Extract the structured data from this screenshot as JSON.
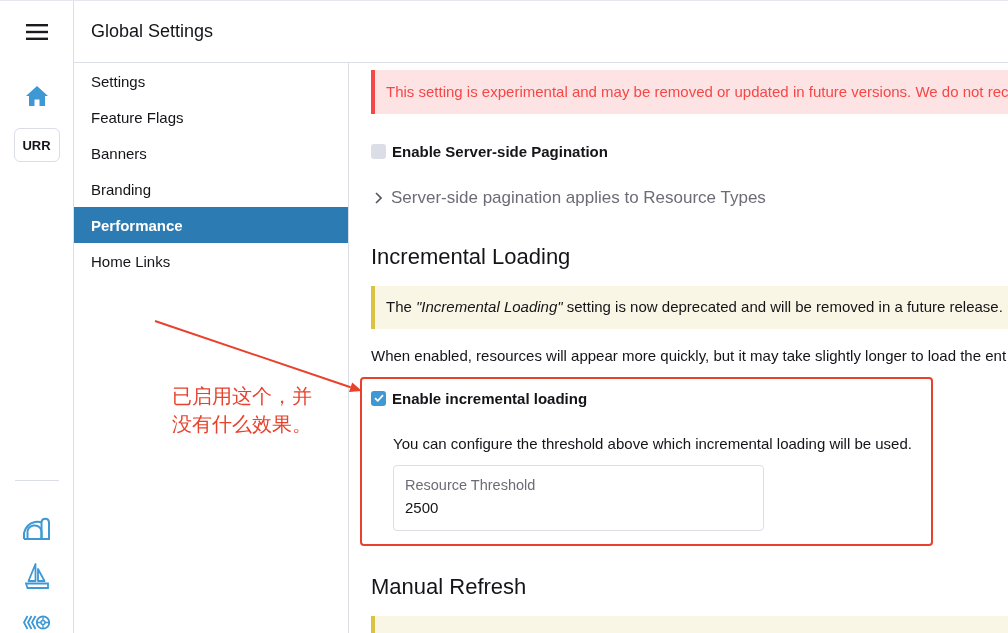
{
  "rail": {
    "cluster_label": "URR"
  },
  "header": {
    "title": "Global Settings"
  },
  "settings_nav": {
    "items": [
      {
        "label": "Settings",
        "selected": false
      },
      {
        "label": "Feature Flags",
        "selected": false
      },
      {
        "label": "Banners",
        "selected": false
      },
      {
        "label": "Branding",
        "selected": false
      },
      {
        "label": "Performance",
        "selected": true
      },
      {
        "label": "Home Links",
        "selected": false
      }
    ]
  },
  "performance": {
    "experimental_banner": {
      "kind": "error",
      "text": "This setting is experimental and may be removed or updated in future versions. We do not rec"
    },
    "server_pagination": {
      "label": "Enable Server-side Pagination",
      "checked": false
    },
    "pagination_resource_types": {
      "label": "Server-side pagination applies to Resource Types",
      "expanded": false
    },
    "incremental_loading": {
      "heading": "Incremental Loading",
      "banner": {
        "kind": "warning",
        "text": "The *\"Incremental Loading\"* setting is now deprecated and will be removed in a future release."
      },
      "description": "When enabled, resources will appear more quickly, but it may take slightly longer to load the ent",
      "option": {
        "label": "Enable incremental loading",
        "checked": true,
        "highlighted": true
      },
      "hint": "You can configure the threshold above which incremental loading will be used.",
      "threshold_field": {
        "label": "Resource Threshold",
        "value": "2500"
      }
    },
    "manual_refresh": {
      "heading": "Manual Refresh",
      "banner": {
        "kind": "warning"
      }
    }
  },
  "annotation": {
    "note": "已启用这个，并没有什么效果。"
  }
}
